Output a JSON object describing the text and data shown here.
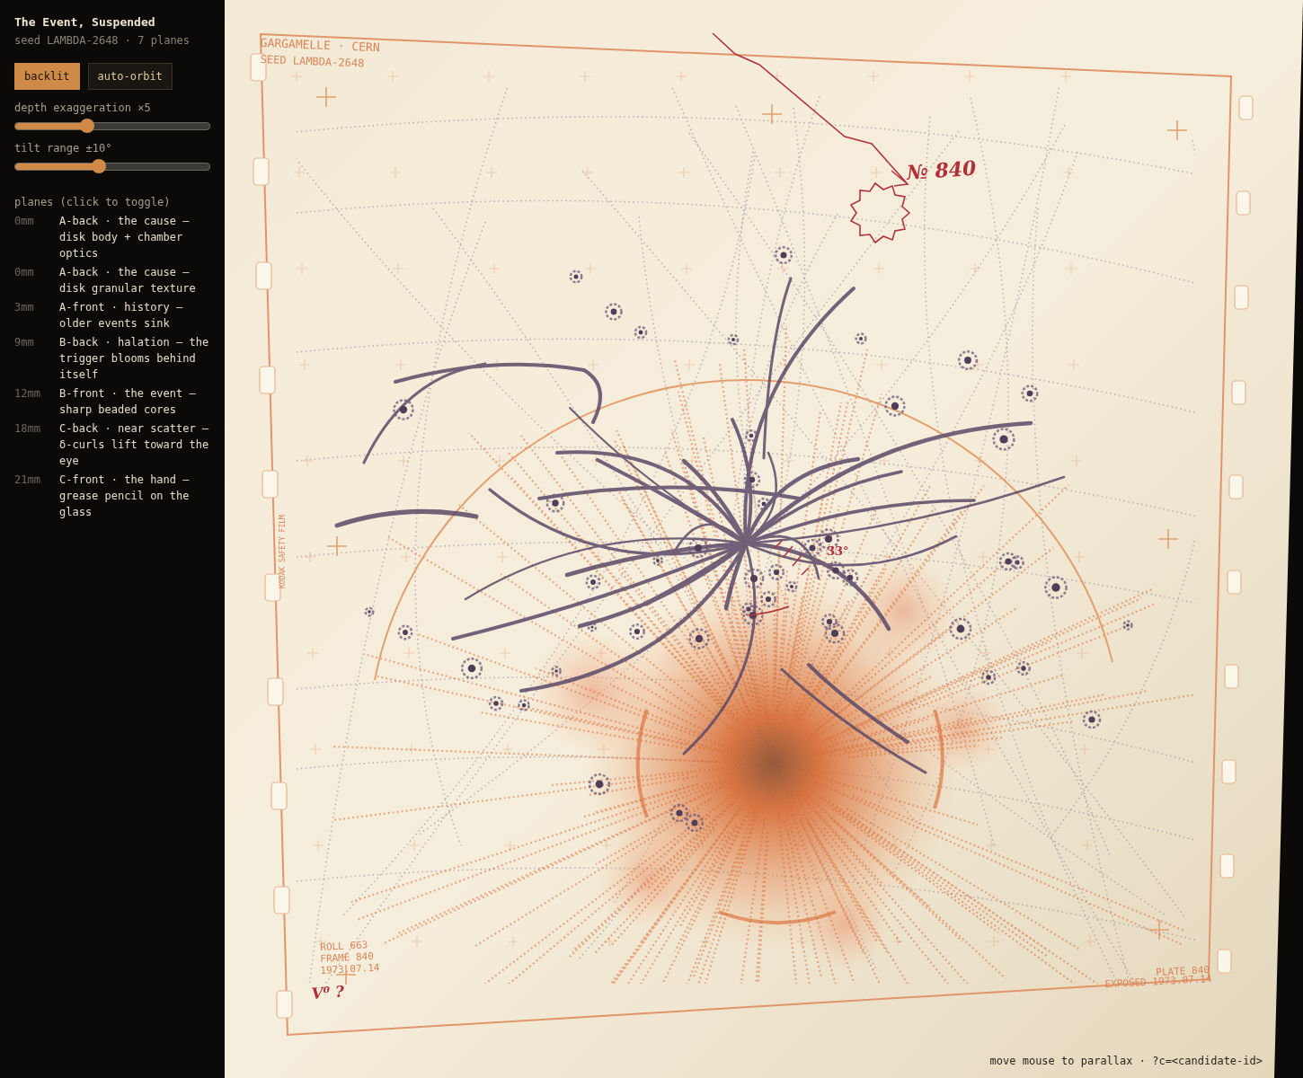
{
  "sidebar": {
    "title": "The Event, Suspended",
    "subtitle": "seed LAMBDA-2648 · 7 planes",
    "toggles": [
      {
        "label": "backlit",
        "on": true
      },
      {
        "label": "auto-orbit",
        "on": false
      }
    ],
    "sliders": [
      {
        "label": "depth exaggeration ×5",
        "level": 0.37
      },
      {
        "label": "tilt range ±10°",
        "level": 0.43
      }
    ],
    "planes_heading": "planes (click to toggle)",
    "planes": [
      {
        "depth": "0mm",
        "label": "A-back · the cause — disk body + chamber optics"
      },
      {
        "depth": "0mm",
        "label": "A-back · the cause — disk granular texture"
      },
      {
        "depth": "3mm",
        "label": "A-front · history — older events sink"
      },
      {
        "depth": "9mm",
        "label": "B-back · halation — the trigger blooms behind itself"
      },
      {
        "depth": "12mm",
        "label": "B-front · the event — sharp beaded cores"
      },
      {
        "depth": "18mm",
        "label": "C-back · near scatter — δ-curls lift toward the eye"
      },
      {
        "depth": "21mm",
        "label": "C-front · the hand — grease pencil on the glass"
      }
    ]
  },
  "plate": {
    "header": "GARGAMELLE · CERN",
    "seed": "SEED LAMBDA-2648",
    "film_edge": "KODAK SAFETY FILM",
    "roll_lines": [
      "ROLL 663",
      "FRAME 840",
      "1973.07.14"
    ],
    "plate_lines": [
      "PLATE 840",
      "EXPOSED 1973.07.14"
    ],
    "annotations": [
      {
        "kind": "number",
        "text": "№ 840"
      },
      {
        "kind": "angle",
        "text": "33°"
      },
      {
        "kind": "query",
        "text": "V⁰ ?"
      }
    ]
  },
  "footer": "move mouse to parallax · ?c=<candidate-id>"
}
